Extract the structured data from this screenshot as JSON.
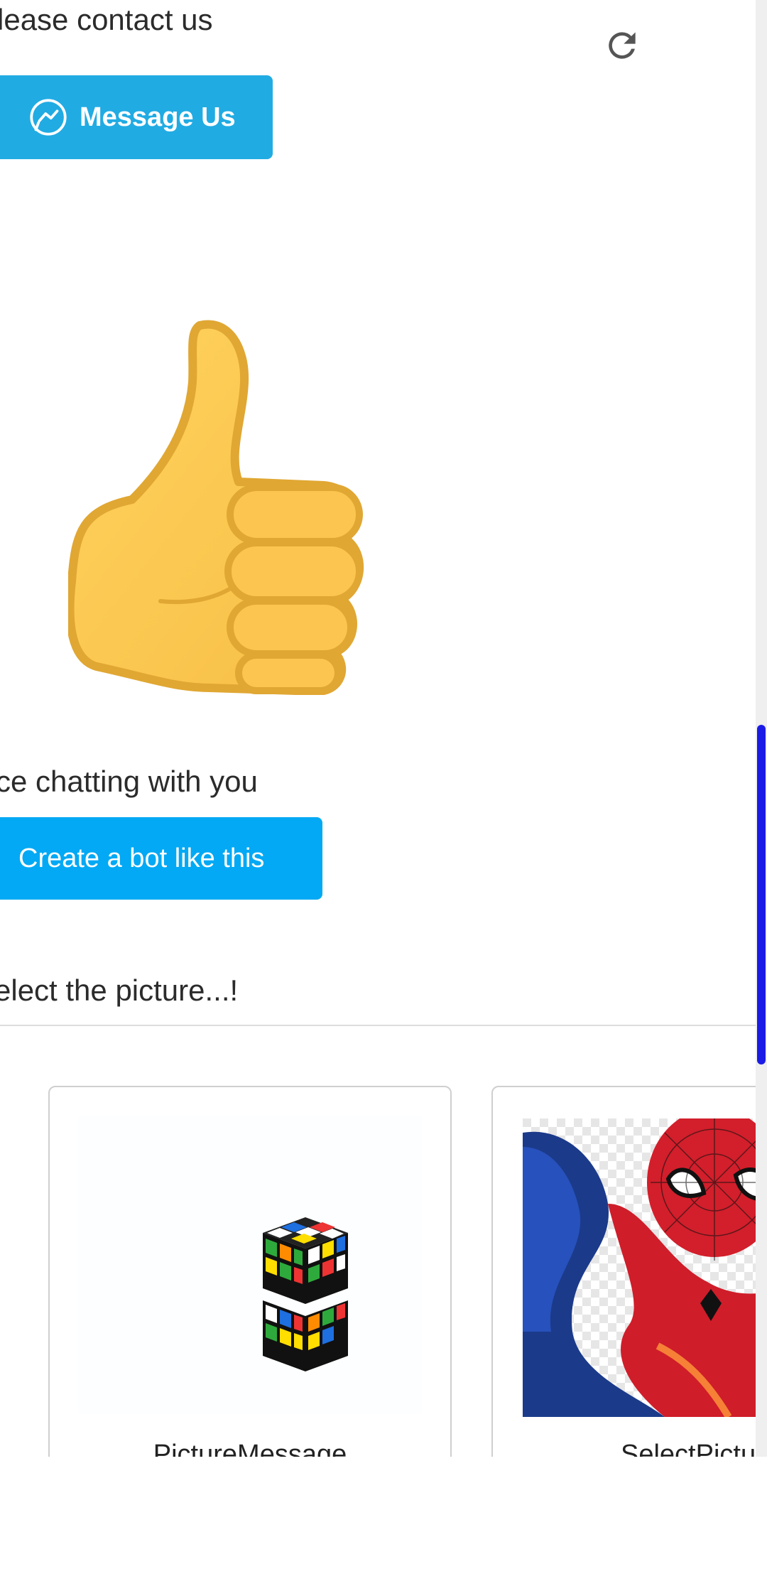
{
  "colors": {
    "primary": "#21abe3",
    "button": "#03a9f4",
    "scrollbar": "#1b1be6"
  },
  "contact": {
    "text": "lease contact us",
    "button_label": "Message Us",
    "icon": "messenger-icon"
  },
  "reaction": {
    "icon": "thumbs-up-icon"
  },
  "chat": {
    "text": "ce chatting with you",
    "button_label": "Create a bot like this"
  },
  "select": {
    "text": "elect the picture...!"
  },
  "cards": [
    {
      "caption": "PictureMessage",
      "image": "rubiks-cube-image"
    },
    {
      "caption": "SelectPictu",
      "image": "spider-man-image"
    }
  ],
  "toolbar": {
    "refresh_icon": "refresh-icon"
  }
}
